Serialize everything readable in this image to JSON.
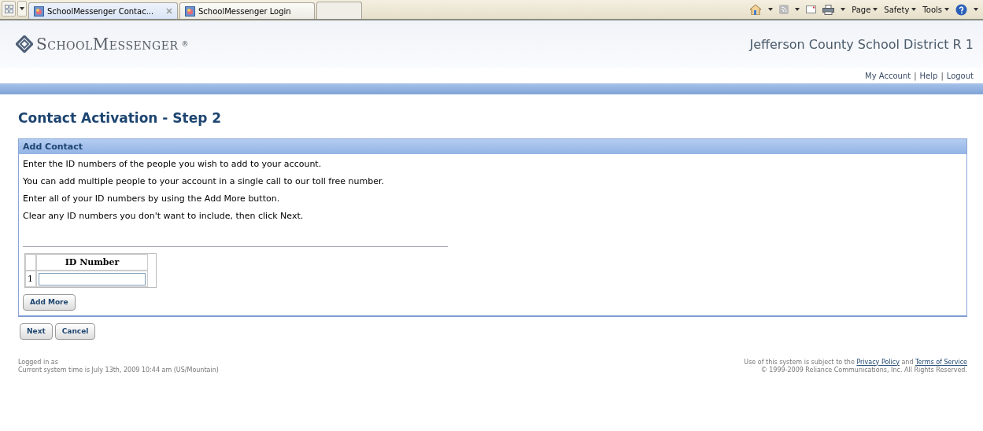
{
  "browser": {
    "tabs": [
      {
        "label": "SchoolMessenger Contac...",
        "selected": true
      },
      {
        "label": "SchoolMessenger Login",
        "selected": false
      }
    ],
    "menus": [
      "Page",
      "Safety",
      "Tools"
    ]
  },
  "header": {
    "logo": "SchoolMessenger",
    "logo_mark": "®",
    "district": "Jefferson County School District R 1",
    "links": [
      "My Account",
      "Help",
      "Logout"
    ],
    "link_separator": "|"
  },
  "page_title": "Contact Activation - Step 2",
  "panel": {
    "title": "Add Contact",
    "lines": [
      "Enter the ID numbers of the people you wish to add to your account.",
      "You can add multiple people to your account in a single call to our toll free number.",
      "Enter all of your ID numbers by using the Add More button.",
      "Clear any ID numbers you don't want to include, then click Next."
    ],
    "table": {
      "columns": [
        "ID Number"
      ],
      "rows": [
        {
          "index": "1",
          "value": ""
        }
      ]
    },
    "add_button": "Add More"
  },
  "buttons": [
    "Next",
    "Cancel"
  ],
  "footer": {
    "left": [
      "Logged in as",
      "Current system time is July 13th, 2009 10:44 am (US/Mountain)"
    ],
    "terms_prefix": "Use of this system is subject to the",
    "privacy": "Privacy Policy",
    "and": "and",
    "terms": "Terms of Service",
    "copyright": "© 1999-2009 Reliance Communications, Inc. All Rights Reserved."
  }
}
